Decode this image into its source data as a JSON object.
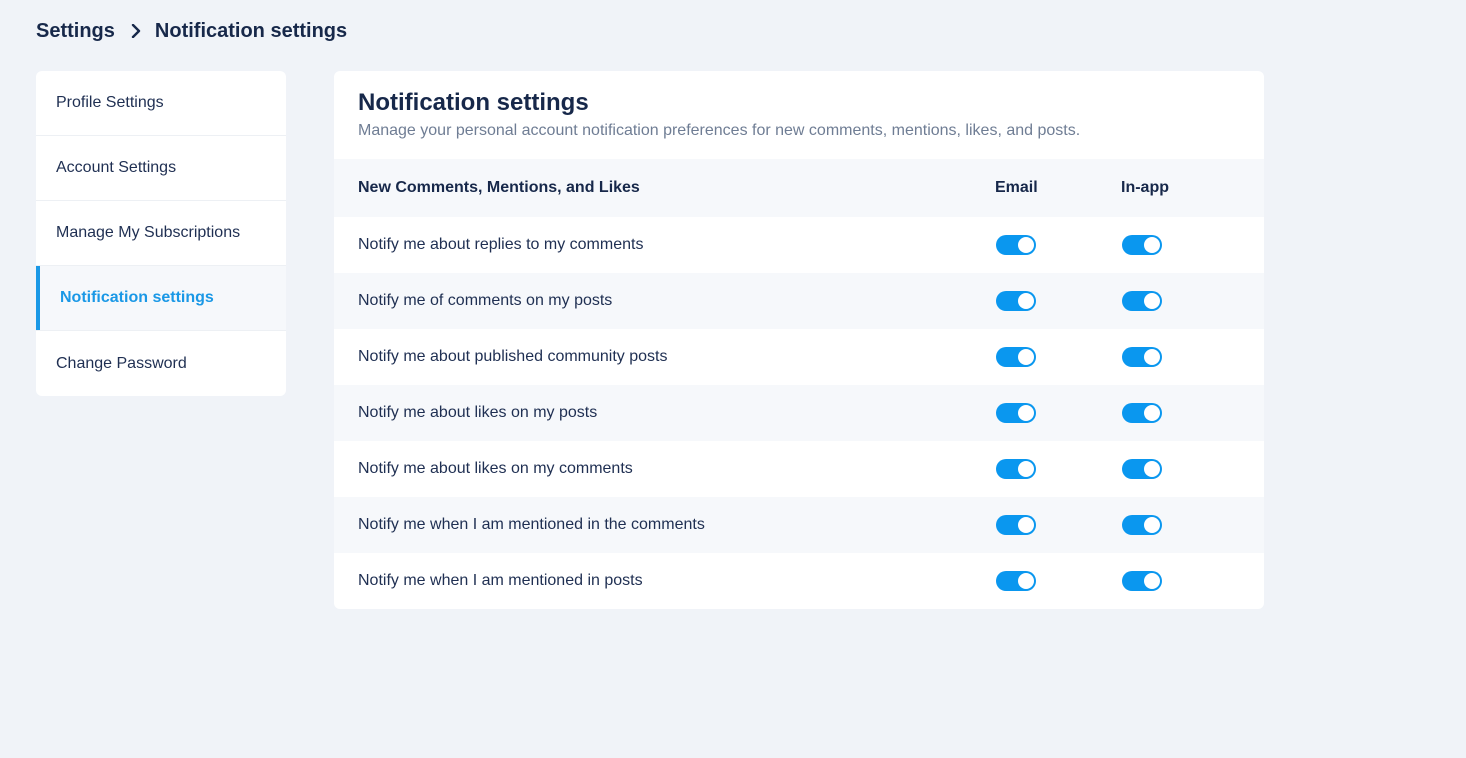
{
  "breadcrumb": {
    "root": "Settings",
    "current": "Notification settings"
  },
  "sidebar": {
    "items": [
      {
        "label": "Profile Settings",
        "active": false
      },
      {
        "label": "Account Settings",
        "active": false
      },
      {
        "label": "Manage My Subscriptions",
        "active": false
      },
      {
        "label": "Notification settings",
        "active": true
      },
      {
        "label": "Change Password",
        "active": false
      }
    ]
  },
  "panel": {
    "title": "Notification settings",
    "subtitle": "Manage your personal account notification preferences for new comments, mentions, likes, and posts.",
    "table": {
      "section_header": "New Comments, Mentions, and Likes",
      "col_email": "Email",
      "col_inapp": "In-app",
      "rows": [
        {
          "label": "Notify me about replies to my comments",
          "email": true,
          "inapp": true
        },
        {
          "label": "Notify me of comments on my posts",
          "email": true,
          "inapp": true
        },
        {
          "label": "Notify me about published community posts",
          "email": true,
          "inapp": true
        },
        {
          "label": "Notify me about likes on my posts",
          "email": true,
          "inapp": true
        },
        {
          "label": "Notify me about likes on my comments",
          "email": true,
          "inapp": true
        },
        {
          "label": "Notify me when I am mentioned in the comments",
          "email": true,
          "inapp": true
        },
        {
          "label": "Notify me when I am mentioned in posts",
          "email": true,
          "inapp": true
        }
      ]
    }
  },
  "colors": {
    "accent": "#1a98e6",
    "toggle_on": "#0a97ef",
    "page_bg": "#f0f3f8",
    "text_dark": "#17284a"
  }
}
